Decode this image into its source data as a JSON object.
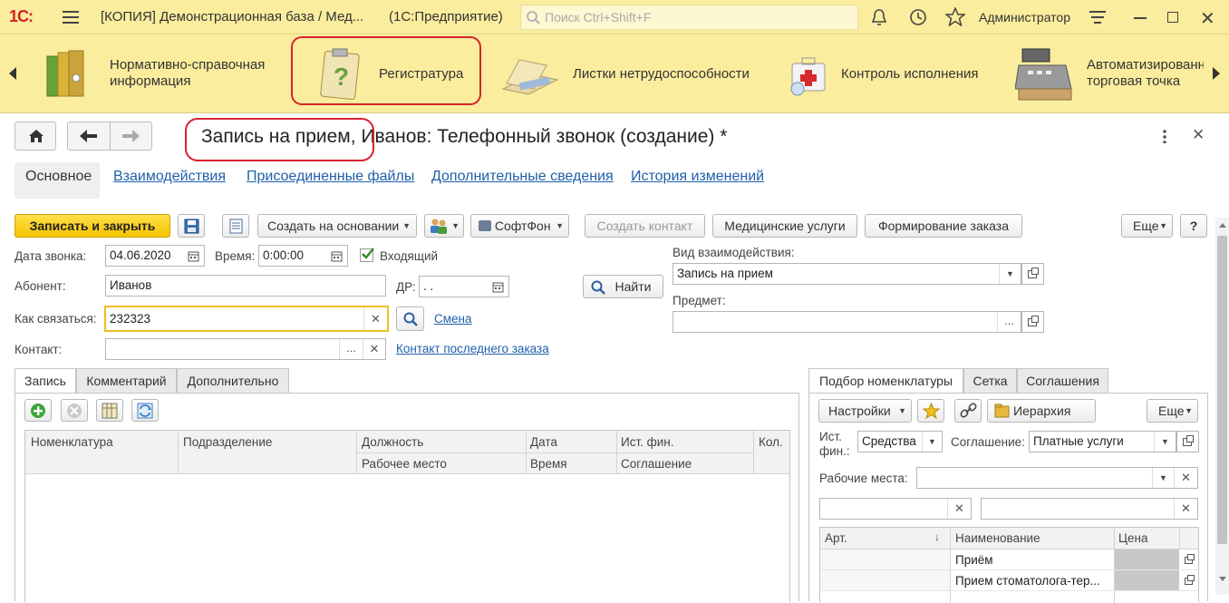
{
  "window": {
    "logo": "1С:",
    "title": "[КОПИЯ] Демонстрационная база / Мед...",
    "platform": "(1С:Предприятие)",
    "search_placeholder": "Поиск Ctrl+Shift+F",
    "user": "Администратор"
  },
  "sections": [
    {
      "label": "Нормативно-справочная информация",
      "icon": "folders-icon"
    },
    {
      "label": "Регистратура",
      "icon": "clipboard-question-icon"
    },
    {
      "label": "Листки нетрудоспособности",
      "icon": "papers-icon"
    },
    {
      "label": "Контроль исполнения",
      "icon": "medical-kit-icon"
    },
    {
      "label": "Автоматизированная торговая точка",
      "icon": "cash-register-icon"
    }
  ],
  "form": {
    "title_part1": "Запись на прием,",
    "title_part2": "Иванов: Телефонный звонок (создание) *",
    "tabs": [
      "Основное",
      "Взаимодействия",
      "Присоединенные файлы",
      "Дополнительные сведения",
      "История изменений"
    ],
    "toolbar": {
      "save_close": "Записать и закрыть",
      "create_based": "Создать на основании",
      "softphone": "СофтФон",
      "create_contact": "Создать контакт",
      "med_services": "Медицинские услуги",
      "order_form": "Формирование заказа",
      "more": "Еще",
      "help": "?"
    },
    "fields": {
      "call_date_label": "Дата звонка:",
      "call_date": "04.06.2020",
      "time_label": "Время:",
      "time": "0:00:00",
      "incoming_label": "Входящий",
      "incoming_checked": true,
      "subscriber_label": "Абонент:",
      "subscriber": "Иванов",
      "dob_label": "ДР:",
      "dob": ". .",
      "find_button": "Найти",
      "contact_how_label": "Как связаться:",
      "contact_how": "232323",
      "change_link": "Смена",
      "contact_label": "Контакт:",
      "contact": "",
      "last_order_link": "Контакт последнего заказа",
      "interaction_type_label": "Вид взаимодействия:",
      "interaction_type": "Запись на прием",
      "subject_label": "Предмет:",
      "subject": ""
    },
    "left_tabs": [
      "Запись",
      "Комментарий",
      "Дополнительно"
    ],
    "left_table": {
      "headers_row1": [
        "Номенклатура",
        "Подразделение",
        "Должность",
        "Дата",
        "Ист. фин.",
        "Кол."
      ],
      "headers_row2": [
        "Рабочее место",
        "Время",
        "Соглашение"
      ]
    },
    "right_tabs": [
      "Подбор номенклатуры",
      "Сетка",
      "Соглашения"
    ],
    "right_panel": {
      "settings": "Настройки",
      "hierarchy": "Иерархия",
      "more": "Еще",
      "fin_source_label": "Ист. фин.:",
      "fin_source": "Средства",
      "agreement_label": "Соглашение:",
      "agreement": "Платные услуги",
      "workplaces_label": "Рабочие места:",
      "workplaces": "",
      "headers": [
        "Арт.",
        "Наименование",
        "Цена"
      ],
      "rows": [
        {
          "art": "",
          "name": "Приём",
          "price": ""
        },
        {
          "art": "",
          "name": "Прием стоматолога-тер...",
          "price": ""
        }
      ]
    }
  }
}
